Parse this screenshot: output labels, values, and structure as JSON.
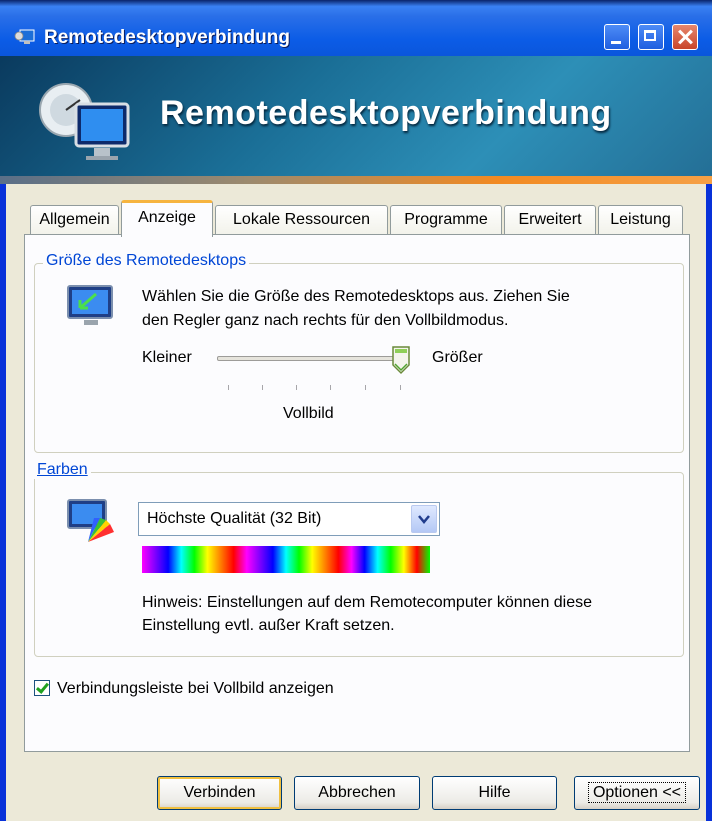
{
  "window": {
    "title": "Remotedesktopverbindung",
    "banner_heading": "Remotedesktopverbindung"
  },
  "tabs": [
    {
      "label": "Allgemein",
      "active": false
    },
    {
      "label": "Anzeige",
      "active": true
    },
    {
      "label": "Lokale Ressourcen",
      "active": false
    },
    {
      "label": "Programme",
      "active": false
    },
    {
      "label": "Erweitert",
      "active": false
    },
    {
      "label": "Leistung",
      "active": false
    }
  ],
  "size_group": {
    "legend": "Größe des Remotedesktops",
    "description_line1": "Wählen Sie die Größe des Remotedesktops aus. Ziehen Sie",
    "description_line2": "den Regler ganz nach rechts für den Vollbildmodus.",
    "slider_min_label": "Kleiner",
    "slider_max_label": "Größer",
    "slider_value_label": "Vollbild",
    "slider_position": 1.0
  },
  "colors_group": {
    "legend": "Farben",
    "selected": "Höchste Qualität (32 Bit)",
    "hint_line1": "Hinweis: Einstellungen auf dem Remotecomputer können diese",
    "hint_line2": "Einstellung evtl. außer Kraft setzen."
  },
  "checkbox": {
    "label": "Verbindungsleiste bei Vollbild anzeigen",
    "checked": true
  },
  "buttons": {
    "connect": "Verbinden",
    "cancel": "Abbrechen",
    "help": "Hilfe",
    "options": "Optionen <<"
  },
  "colors": {
    "titlebar": "#0b5ce6",
    "accent_orange": "#f28a22",
    "legend_blue": "#0046d5",
    "dialog_bg": "#ece9d8"
  }
}
